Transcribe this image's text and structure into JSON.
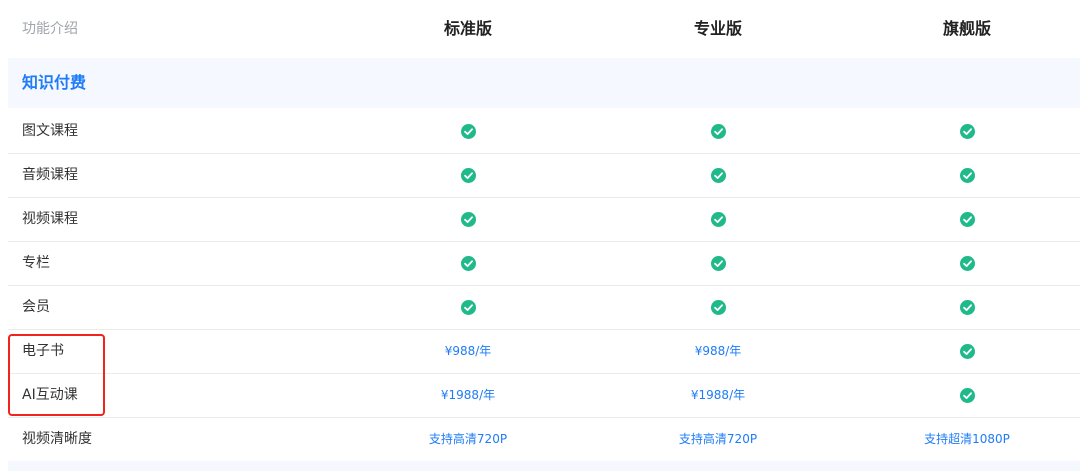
{
  "header": {
    "feature_label": "功能介绍",
    "plans": [
      "标准版",
      "专业版",
      "旗舰版"
    ]
  },
  "section": {
    "title": "知识付费"
  },
  "colors": {
    "accent": "#1f7cf6",
    "check": "#1fb98a",
    "highlight": "#f2231c",
    "section_bg": "#f5f9ff"
  },
  "rows": [
    {
      "name": "图文课程",
      "values": [
        "check",
        "check",
        "check"
      ]
    },
    {
      "name": "音频课程",
      "values": [
        "check",
        "check",
        "check"
      ]
    },
    {
      "name": "视频课程",
      "values": [
        "check",
        "check",
        "check"
      ]
    },
    {
      "name": "专栏",
      "values": [
        "check",
        "check",
        "check"
      ]
    },
    {
      "name": "会员",
      "values": [
        "check",
        "check",
        "check"
      ]
    },
    {
      "name": "电子书",
      "values": [
        "¥988/年",
        "¥988/年",
        "check"
      ]
    },
    {
      "name": "AI互动课",
      "values": [
        "¥1988/年",
        "¥1988/年",
        "check"
      ]
    },
    {
      "name": "视频清晰度",
      "values": [
        "支持高清720P",
        "支持高清720P",
        "支持超清1080P"
      ]
    }
  ]
}
